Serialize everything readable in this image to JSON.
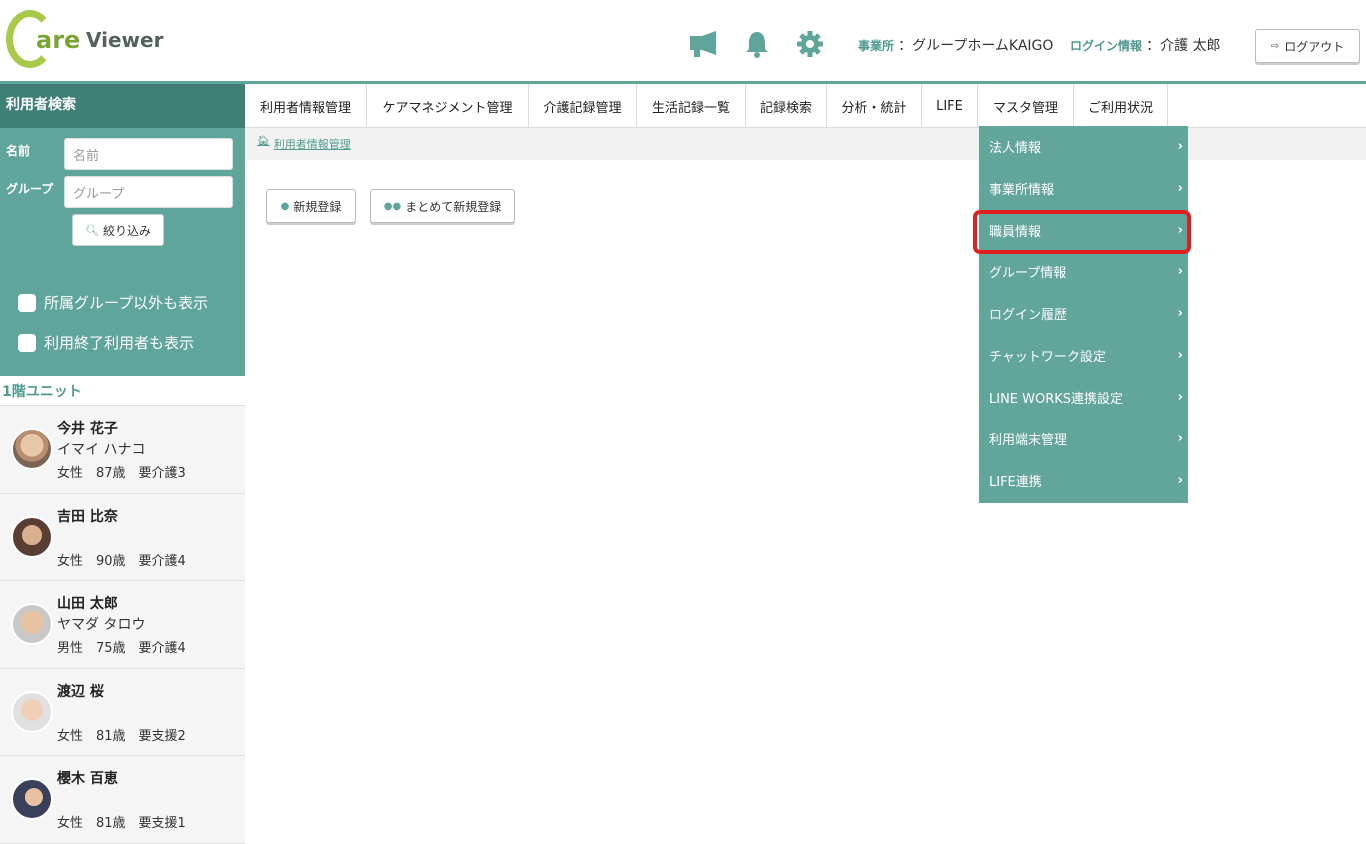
{
  "header": {
    "logo_c": "C",
    "logo_are": "are",
    "logo_viewer": "Viewer",
    "icons": [
      "megaphone-icon",
      "bell-icon",
      "gear-icon"
    ],
    "office_label": "事業所",
    "office_value": "：グループホームKAIGO",
    "login_label": "ログイン情報",
    "login_value": "：介護 太郎",
    "logout_label": "ログアウト"
  },
  "sidebar": {
    "title": "利用者検索",
    "name_label": "名前",
    "name_placeholder": "名前",
    "group_label": "グループ",
    "group_placeholder": "グループ",
    "filter_label": "絞り込み",
    "check_other_groups": "所属グループ以外も表示",
    "check_ended_users": "利用終了利用者も表示",
    "unit_title": "1階ユニット",
    "users": [
      {
        "name": "今井 花子",
        "kana": "イマイ ハナコ",
        "info": "女性　87歳　要介護3"
      },
      {
        "name": "吉田 比奈",
        "kana": "",
        "info": "女性　90歳　要介護4"
      },
      {
        "name": "山田 太郎",
        "kana": "ヤマダ タロウ",
        "info": "男性　75歳　要介護4"
      },
      {
        "name": "渡辺 桜",
        "kana": "",
        "info": "女性　81歳　要支援2"
      },
      {
        "name": "櫻木 百恵",
        "kana": "",
        "info": "女性　81歳　要支援1"
      }
    ]
  },
  "nav": {
    "tabs": [
      "利用者情報管理",
      "ケアマネジメント管理",
      "介護記録管理",
      "生活記録一覧",
      "記録検索",
      "分析・統計",
      "LIFE",
      "マスタ管理",
      "ご利用状況"
    ],
    "active_tab": "マスタ管理"
  },
  "breadcrumb": "利用者情報管理",
  "actions": {
    "new_label": "新規登録",
    "bulk_new_label": "まとめて新規登録"
  },
  "dropdown": {
    "items": [
      "法人情報",
      "事業所情報",
      "職員情報",
      "グループ情報",
      "ログイン履歴",
      "チャットワーク設定",
      "LINE WORKS連携設定",
      "利用端末管理",
      "LIFE連携"
    ],
    "highlighted": "職員情報"
  },
  "colors": {
    "accent": "#5fa59c",
    "accent_dark": "#3f7f76",
    "logo_green": "#a9c94a",
    "highlight": "#e02020"
  }
}
